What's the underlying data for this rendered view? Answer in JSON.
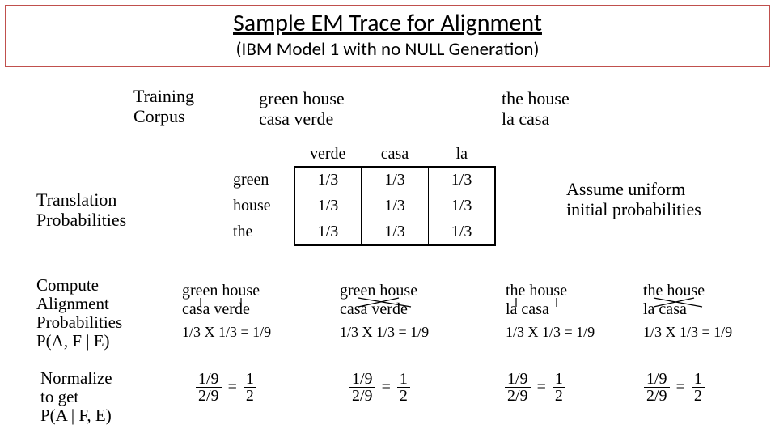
{
  "title": {
    "main": "Sample EM Trace for Alignment",
    "sub": "(IBM Model 1 with no NULL Generation)"
  },
  "labels": {
    "training_corpus": "Training\nCorpus",
    "translation_probabilities": "Translation\nProbabilities",
    "assume_uniform": "Assume uniform\ninitial probabilities",
    "compute_alignment": "Compute\nAlignment\nProbabilities\nP(A, F | E)",
    "normalize": "Normalize\nto get\nP(A | F, E)"
  },
  "corpus": {
    "pair1": {
      "en": "green house",
      "es": "casa verde"
    },
    "pair2": {
      "en": "the house",
      "es": "la casa"
    }
  },
  "table": {
    "cols": [
      "verde",
      "casa",
      "la"
    ],
    "rows": [
      {
        "label": "green",
        "cells": [
          "1/3",
          "1/3",
          "1/3"
        ]
      },
      {
        "label": "house",
        "cells": [
          "1/3",
          "1/3",
          "1/3"
        ]
      },
      {
        "label": "the",
        "cells": [
          "1/3",
          "1/3",
          "1/3"
        ]
      }
    ]
  },
  "alignments": [
    {
      "en": "green house",
      "es": "casa verde",
      "calc": "1/3 X 1/3 = 1/9"
    },
    {
      "en": "green house",
      "es": "casa verde",
      "calc": "1/3 X 1/3 = 1/9"
    },
    {
      "en": "the house",
      "es": "la casa",
      "calc": "1/3 X 1/3 = 1/9"
    },
    {
      "en": "the house",
      "es": "la casa",
      "calc": "1/3 X 1/3 = 1/9"
    }
  ],
  "fractions": [
    {
      "lhs_num": "1/9",
      "lhs_den": "2/9",
      "rhs_num": "1",
      "rhs_den": "2"
    },
    {
      "lhs_num": "1/9",
      "lhs_den": "2/9",
      "rhs_num": "1",
      "rhs_den": "2"
    },
    {
      "lhs_num": "1/9",
      "lhs_den": "2/9",
      "rhs_num": "1",
      "rhs_den": "2"
    },
    {
      "lhs_num": "1/9",
      "lhs_den": "2/9",
      "rhs_num": "1",
      "rhs_den": "2"
    }
  ],
  "eq": "="
}
